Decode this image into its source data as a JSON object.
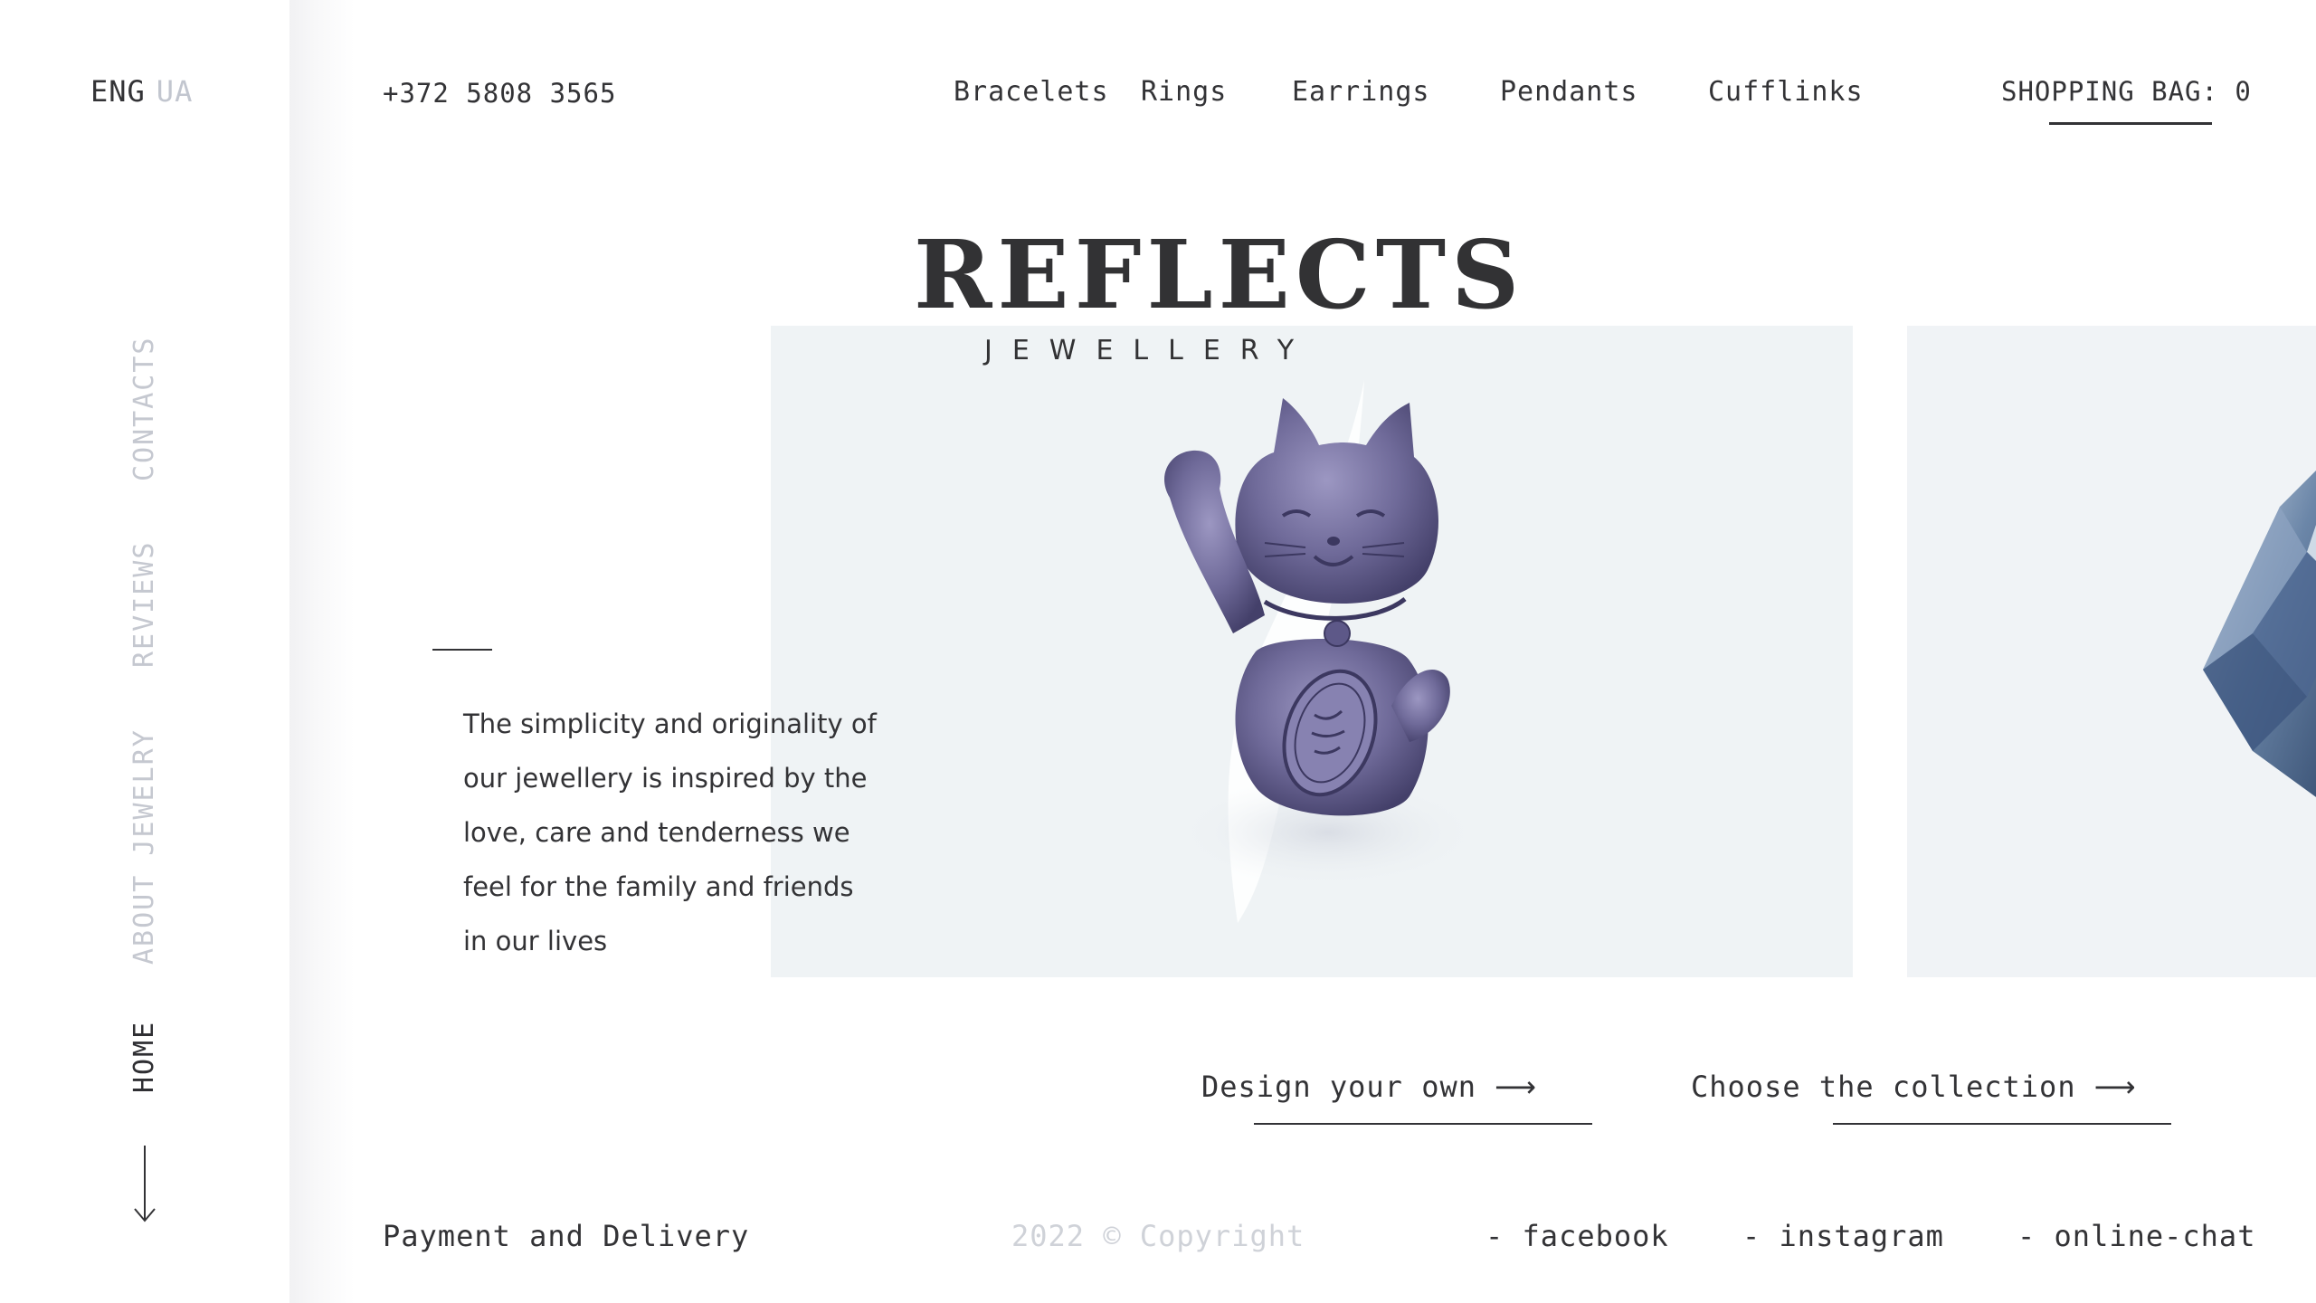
{
  "language": {
    "current": "ENG",
    "alternate": "UA"
  },
  "sidebar": {
    "items": [
      {
        "label": "CONTACTS",
        "active": false
      },
      {
        "label": "REVIEWS",
        "active": false
      },
      {
        "label": "ABOUT JEWELRY",
        "active": false
      },
      {
        "label": "HOME",
        "active": true
      }
    ],
    "scroll_icon": "arrow-down-icon"
  },
  "header": {
    "phone": "+372 5808 3565",
    "nav": [
      "Bracelets",
      "Rings",
      "Earrings",
      "Pendants",
      "Cufflinks"
    ],
    "bag_label": "SHOPPING BAG: 0"
  },
  "brand": {
    "name": "REFLECTS",
    "tagline": "JEWELLERY"
  },
  "hero": {
    "intro_lines": [
      "The simplicity and originality of",
      "our jewellery is inspired by the",
      "love, care and tenderness we",
      "feel for the family and friends",
      "in our lives"
    ],
    "main_image": "maneki-neko-cat-pendant",
    "side_image": "faceted-blue-gem"
  },
  "cta": {
    "design": "Design your own",
    "collection": "Choose the collection",
    "arrow_icon": "arrow-right-icon"
  },
  "footer": {
    "payment": "Payment and Delivery",
    "copyright": "2022 © Copyright",
    "links": [
      "- facebook",
      "- instagram",
      "- online-chat"
    ]
  },
  "colors": {
    "text": "#333336",
    "muted": "#c5c8d0",
    "panel": "#eff3f5",
    "pendant": "#6f6a99"
  }
}
